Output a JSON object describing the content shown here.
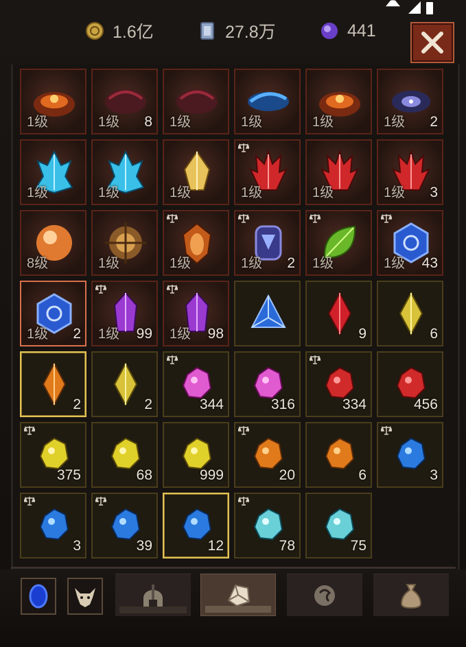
{
  "currency": {
    "gold": {
      "value": "1.6亿",
      "icon": "gold-coin-icon"
    },
    "platinum": {
      "value": "27.8万",
      "icon": "platinum-icon"
    },
    "orb": {
      "value": "441",
      "icon": "purple-orb-icon"
    }
  },
  "close_icon": "close-icon",
  "colors": {
    "close_bg": "#7a2a18",
    "select_gold": "#e2c257",
    "select_red": "#d9704b"
  },
  "items": [
    {
      "lvl": "1级",
      "cnt": "",
      "style": "red",
      "art": "fire-relic",
      "trade": false
    },
    {
      "lvl": "1级",
      "cnt": "8",
      "style": "red",
      "art": "blood-relic",
      "trade": false
    },
    {
      "lvl": "1级",
      "cnt": "",
      "style": "red",
      "art": "blood-relic",
      "trade": false
    },
    {
      "lvl": "1级",
      "cnt": "",
      "style": "red",
      "art": "water-relic",
      "trade": false
    },
    {
      "lvl": "1级",
      "cnt": "",
      "style": "red",
      "art": "fire-relic",
      "trade": false
    },
    {
      "lvl": "1级",
      "cnt": "2",
      "style": "red",
      "art": "void-relic",
      "trade": false
    },
    {
      "lvl": "1级",
      "cnt": "",
      "style": "red",
      "art": "ice-crystal",
      "trade": false
    },
    {
      "lvl": "1级",
      "cnt": "",
      "style": "red",
      "art": "ice-crystal",
      "trade": false
    },
    {
      "lvl": "1级",
      "cnt": "",
      "style": "red",
      "art": "gold-crystal",
      "trade": false
    },
    {
      "lvl": "1级",
      "cnt": "",
      "style": "red",
      "art": "red-crystal",
      "trade": true
    },
    {
      "lvl": "1级",
      "cnt": "",
      "style": "red",
      "art": "red-crystal",
      "trade": false
    },
    {
      "lvl": "1级",
      "cnt": "3",
      "style": "red",
      "art": "red-crystal",
      "trade": false
    },
    {
      "lvl": "8级",
      "cnt": "",
      "style": "red",
      "art": "fire-orb",
      "trade": false
    },
    {
      "lvl": "1级",
      "cnt": "",
      "style": "red",
      "art": "bronze-orb",
      "trade": false
    },
    {
      "lvl": "1级",
      "cnt": "",
      "style": "red",
      "art": "amber-gem",
      "trade": true
    },
    {
      "lvl": "1级",
      "cnt": "2",
      "style": "red",
      "art": "blue-rune",
      "trade": true
    },
    {
      "lvl": "1级",
      "cnt": "",
      "style": "red",
      "art": "green-leaf",
      "trade": true
    },
    {
      "lvl": "1级",
      "cnt": "43",
      "style": "red",
      "art": "blue-hex",
      "trade": true
    },
    {
      "lvl": "1级",
      "cnt": "2",
      "style": "selred",
      "art": "blue-hex",
      "trade": false
    },
    {
      "lvl": "1级",
      "cnt": "99",
      "style": "red",
      "art": "purple-crystal",
      "trade": true
    },
    {
      "lvl": "1级",
      "cnt": "98",
      "style": "red",
      "art": "purple-crystal",
      "trade": true
    },
    {
      "lvl": "",
      "cnt": "",
      "style": "gold",
      "art": "blue-triangle",
      "trade": false
    },
    {
      "lvl": "",
      "cnt": "9",
      "style": "gold",
      "art": "red-marquise",
      "trade": false
    },
    {
      "lvl": "",
      "cnt": "6",
      "style": "gold",
      "art": "yellow-marquise",
      "trade": false
    },
    {
      "lvl": "",
      "cnt": "2",
      "style": "sel",
      "art": "orange-marquise",
      "trade": false
    },
    {
      "lvl": "",
      "cnt": "2",
      "style": "gold",
      "art": "yellow-marquise",
      "trade": false
    },
    {
      "lvl": "",
      "cnt": "344",
      "style": "gold",
      "art": "pink-stone",
      "trade": true
    },
    {
      "lvl": "",
      "cnt": "316",
      "style": "gold",
      "art": "pink-stone",
      "trade": false
    },
    {
      "lvl": "",
      "cnt": "334",
      "style": "gold",
      "art": "red-stone",
      "trade": true
    },
    {
      "lvl": "",
      "cnt": "456",
      "style": "gold",
      "art": "red-stone",
      "trade": false
    },
    {
      "lvl": "",
      "cnt": "375",
      "style": "gold",
      "art": "yellow-stone",
      "trade": true
    },
    {
      "lvl": "",
      "cnt": "68",
      "style": "gold",
      "art": "yellow-stone",
      "trade": false
    },
    {
      "lvl": "",
      "cnt": "999",
      "style": "gold",
      "art": "yellow-stone",
      "trade": false
    },
    {
      "lvl": "",
      "cnt": "20",
      "style": "gold",
      "art": "orange-stone",
      "trade": true
    },
    {
      "lvl": "",
      "cnt": "6",
      "style": "gold",
      "art": "orange-stone",
      "trade": false
    },
    {
      "lvl": "",
      "cnt": "3",
      "style": "gold",
      "art": "blue-stone",
      "trade": true
    },
    {
      "lvl": "",
      "cnt": "3",
      "style": "gold",
      "art": "blue-stone",
      "trade": true
    },
    {
      "lvl": "",
      "cnt": "39",
      "style": "gold",
      "art": "blue-stone",
      "trade": true
    },
    {
      "lvl": "",
      "cnt": "12",
      "style": "sel",
      "art": "blue-stone",
      "trade": false
    },
    {
      "lvl": "",
      "cnt": "78",
      "style": "gold",
      "art": "teal-stone",
      "trade": true
    },
    {
      "lvl": "",
      "cnt": "75",
      "style": "gold",
      "art": "teal-stone",
      "trade": false
    }
  ],
  "bottom": {
    "buttons": [
      "blue-gem-button",
      "beast-mask-button"
    ],
    "tabs": [
      {
        "name": "helmet-tab",
        "active": false
      },
      {
        "name": "gem-tab",
        "active": true
      },
      {
        "name": "rune-tab",
        "active": false
      },
      {
        "name": "bag-tab",
        "active": false
      }
    ]
  }
}
